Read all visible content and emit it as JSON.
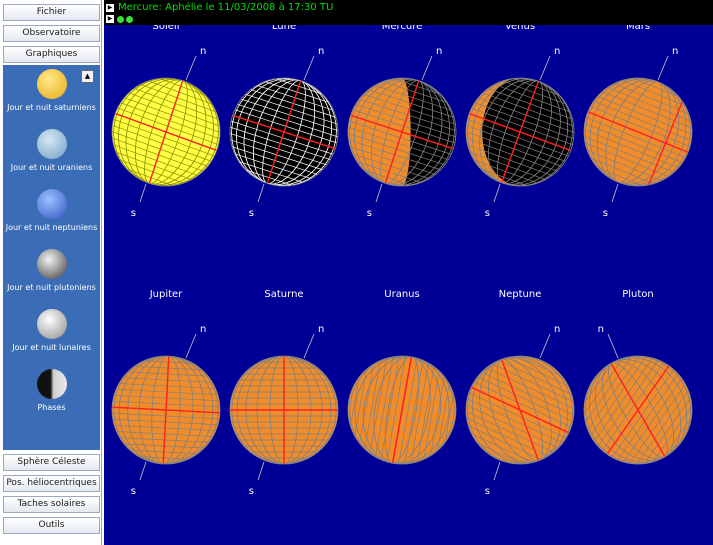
{
  "sidebar": {
    "top_buttons": [
      "Fichier",
      "Observatoire",
      "Graphiques"
    ],
    "tools": [
      {
        "label": "Jour et nuit saturniens",
        "icon": "saturn-day-night-icon",
        "color": "#f2c32c"
      },
      {
        "label": "Jour et nuit uraniens",
        "icon": "uranus-day-night-icon",
        "color": "#8fb7d8"
      },
      {
        "label": "Jour et nuit neptuniens",
        "icon": "neptune-day-night-icon",
        "color": "#4f78d6"
      },
      {
        "label": "Jour et nuit plutoniens",
        "icon": "pluto-day-night-icon",
        "color": "#9a9a9a"
      },
      {
        "label": "Jour et nuit lunaires",
        "icon": "moon-day-night-icon",
        "color": "#c9c9c9"
      },
      {
        "label": "Phases",
        "icon": "phases-icon",
        "color": "#bdbdbd"
      }
    ],
    "bottom_buttons": [
      "Sphère Céleste",
      "Pos. héliocentriques",
      "Taches solaires",
      "Outils"
    ]
  },
  "header": {
    "title": "Mercure: Aphélie le 11/03/2008 à 17:30 TU"
  },
  "pole_labels": {
    "north": "n",
    "south": "s"
  },
  "bodies": [
    {
      "name": "Soleil",
      "fill": "#ffff44",
      "grid": "#909000",
      "lit": 1.0,
      "equator_tilt": 20,
      "meridian_tilt": 18,
      "meridian_offset": 0,
      "north_axis": "up-right",
      "south_label": true
    },
    {
      "name": "Lune",
      "fill": "#000000",
      "grid": "#ffffff",
      "lit": 0.0,
      "equator_tilt": 18,
      "meridian_tilt": 18,
      "meridian_offset": 0,
      "north_axis": "up-right",
      "south_label": true
    },
    {
      "name": "Mercure",
      "fill": "#f08c2a",
      "grid": "#808080",
      "lit": 0.42,
      "equator_tilt": 18,
      "meridian_tilt": 18,
      "meridian_offset": 0,
      "north_axis": "up-right",
      "south_label": true
    },
    {
      "name": "Vénus",
      "fill": "#f08c2a",
      "grid": "#808080",
      "lit": 0.85,
      "equator_tilt": 20,
      "meridian_tilt": 20,
      "meridian_offset": 0,
      "north_axis": "up-right",
      "south_label": true
    },
    {
      "name": "Mars",
      "fill": "#f08c2a",
      "grid": "#808080",
      "lit": 1.0,
      "equator_tilt": 22,
      "meridian_tilt": 22,
      "meridian_offset": 0.55,
      "north_axis": "up-right",
      "south_label": true
    },
    {
      "name": "Jupiter",
      "fill": "#f08c2a",
      "grid": "#808080",
      "lit": 1.0,
      "equator_tilt": 3,
      "meridian_tilt": 3,
      "meridian_offset": 0,
      "north_axis": "up-right",
      "south_label": true
    },
    {
      "name": "Saturne",
      "fill": "#f08c2a",
      "grid": "#808080",
      "lit": 1.0,
      "equator_tilt": 0,
      "meridian_tilt": 0,
      "meridian_offset": 0,
      "north_axis": "up-right",
      "south_label": true
    },
    {
      "name": "Uranus",
      "fill": "#f08c2a",
      "grid": "#808080",
      "lit": 1.0,
      "equator_tilt": -80,
      "meridian_tilt": 10,
      "meridian_offset": 0,
      "north_axis": "none",
      "south_label": false
    },
    {
      "name": "Neptune",
      "fill": "#f08c2a",
      "grid": "#808080",
      "lit": 1.0,
      "equator_tilt": 25,
      "meridian_tilt": -20,
      "meridian_offset": 0,
      "north_axis": "up-right",
      "south_label": true
    },
    {
      "name": "Pluton",
      "fill": "#f08c2a",
      "grid": "#808080",
      "lit": 1.0,
      "equator_tilt": -55,
      "meridian_tilt": -30,
      "meridian_offset": 0,
      "north_axis": "up-left",
      "south_label": false
    }
  ]
}
